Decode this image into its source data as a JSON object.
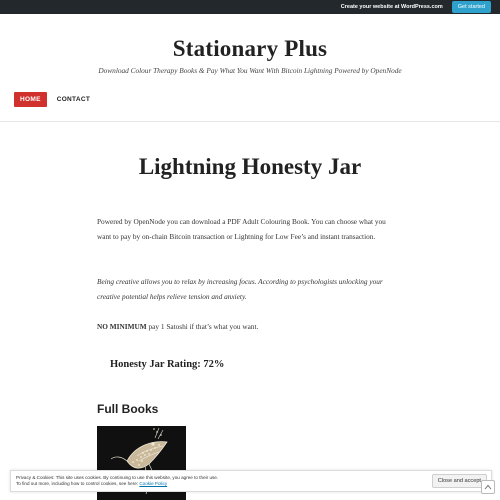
{
  "promo": {
    "text": "Create your website at WordPress.com",
    "button": "Get started"
  },
  "site": {
    "title": "Stationary Plus",
    "tagline": "Download Colour Therapy Books & Pay What You Want With Bitcoin Lightning Powered by OpenNode"
  },
  "nav": {
    "items": [
      {
        "label": "HOME",
        "active": true
      },
      {
        "label": "CONTACT",
        "active": false
      }
    ]
  },
  "page": {
    "title": "Lightning Honesty Jar",
    "paragraph1": "Powered by OpenNode you can download a PDF Adult Colouring Book. You can choose what you want to pay by on-chain Bitcoin transaction or Lightning for Low Fee’s and instant transaction.",
    "paragraph2": "Being creative allows you to relax by increasing focus. According to psychologists unlocking your creative potential helps relieve tension and anxiety.",
    "paragraph3_bold": "NO MINIMUM",
    "paragraph3_rest": " pay 1 Satoshi if that’s what you want.",
    "rating": "Honesty Jar Rating: 72%",
    "books_heading": "Full Books"
  },
  "cookie": {
    "line1": "Privacy & Cookies: This site uses cookies. By continuing to use this website, you agree to their use.",
    "line2": "To find out more, including how to control cookies, see here: ",
    "link": "Cookie Policy",
    "button": "Close and accept"
  },
  "colors": {
    "accent": "#d0312d",
    "topbar": "#23282d",
    "promo_button": "#2ea2cc"
  },
  "icons": {
    "follow": "follow-icon",
    "cover": "book-cover-image"
  }
}
